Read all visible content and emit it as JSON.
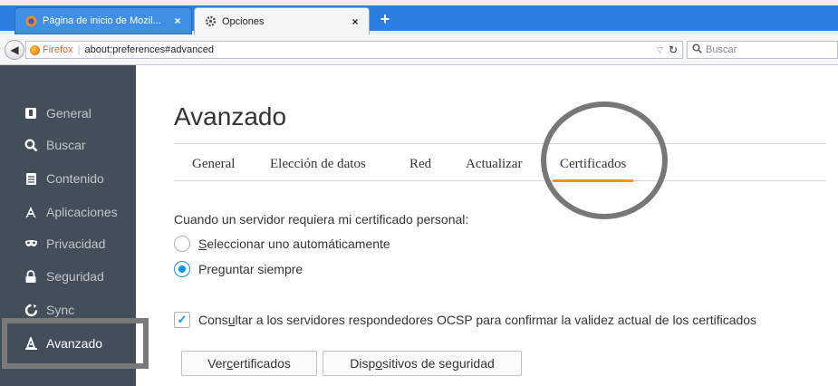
{
  "browser": {
    "tabs": [
      {
        "label": "Página de inicio de Mozil...",
        "icon": "firefox-icon",
        "close": "×"
      },
      {
        "label": "Opciones",
        "icon": "gear-icon",
        "close": "×"
      }
    ],
    "new_tab": "+",
    "identity": "Firefox",
    "url": "about:preferences#advanced",
    "search_placeholder": "Buscar"
  },
  "sidebar": {
    "items": [
      {
        "label": "General",
        "icon": "general-icon"
      },
      {
        "label": "Buscar",
        "icon": "search-icon"
      },
      {
        "label": "Contenido",
        "icon": "document-icon"
      },
      {
        "label": "Aplicaciones",
        "icon": "rocket-icon"
      },
      {
        "label": "Privacidad",
        "icon": "mask-icon"
      },
      {
        "label": "Seguridad",
        "icon": "lock-icon"
      },
      {
        "label": "Sync",
        "icon": "sync-icon"
      },
      {
        "label": "Avanzado",
        "icon": "wizard-hat-icon",
        "selected": true
      }
    ]
  },
  "main": {
    "title": "Avanzado",
    "tabs": [
      {
        "label": "General"
      },
      {
        "label": "Elección de datos"
      },
      {
        "label": "Red"
      },
      {
        "label": "Actualizar"
      },
      {
        "label": "Certificados",
        "active": true
      }
    ],
    "prompt": "Cuando un servidor requiera mi certificado personal:",
    "radio_auto": {
      "pre": "",
      "accel": "S",
      "post": "eleccionar uno automáticamente",
      "checked": false
    },
    "radio_ask": {
      "pre": "Pre",
      "accel": "g",
      "post": "untar siempre",
      "checked": true
    },
    "ocsp": {
      "pre": "Cons",
      "accel": "u",
      "post": "ltar a los servidores respondedores OCSP para confirmar la validez actual de los certificados",
      "checked": true
    },
    "view_certs_button": {
      "pre": "Ver ",
      "accel": "c",
      "post": "ertificados"
    },
    "devices_button": {
      "pre": "Disp",
      "accel": "o",
      "post": "sitivos de seguridad"
    }
  },
  "colors": {
    "accent": "#ff9500",
    "checked": "#0996f8",
    "sidebar_bg": "#424f5a"
  }
}
